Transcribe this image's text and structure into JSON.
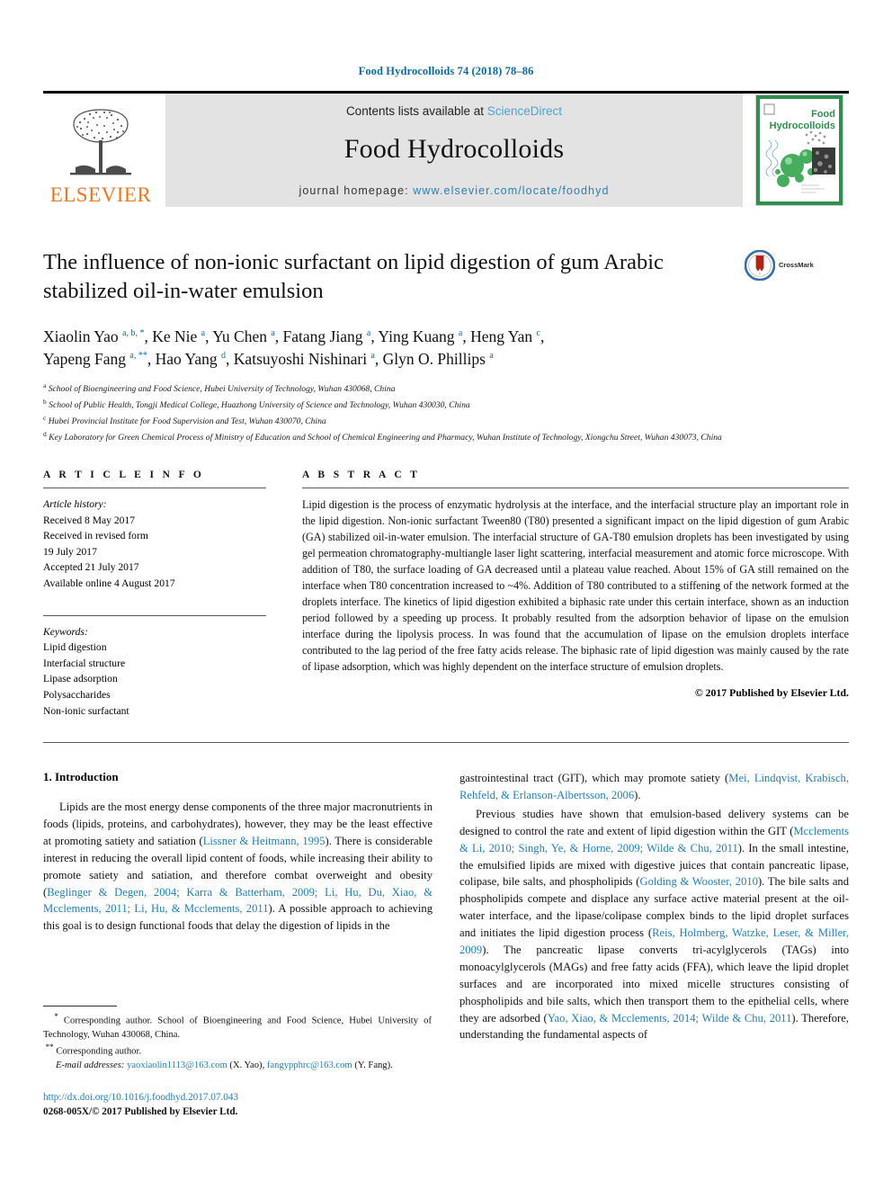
{
  "running_head": "Food Hydrocolloids 74 (2018) 78–86",
  "masthead": {
    "elsevier_wordmark": "ELSEVIER",
    "contents_prefix": "Contents lists available at ",
    "sciencedirect": "ScienceDirect",
    "journal_title": "Food Hydrocolloids",
    "homepage_prefix": "journal homepage: ",
    "homepage_url": "www.elsevier.com/locate/foodhyd",
    "cover_title_line1": "Food",
    "cover_title_line2": "Hydrocolloids",
    "accent_orange": "#e87722",
    "accent_blue": "#2b7fb8",
    "cover_green": "#2f8f4e",
    "banner_bg": "#e3e3e3"
  },
  "article": {
    "title": "The influence of non-ionic surfactant on lipid digestion of gum Arabic stabilized oil-in-water emulsion",
    "crossmark_label": "CrossMark",
    "authors_line1": "Xiaolin Yao a, b, *, Ke Nie a, Yu Chen a, Fatang Jiang a, Ying Kuang a, Heng Yan c,",
    "authors_line2": "Yapeng Fang a, **, Hao Yang d, Katsuyoshi Nishinari a, Glyn O. Phillips a",
    "affiliations": [
      {
        "mark": "a",
        "text": "School of Bioengineering and Food Science, Hubei University of Technology, Wuhan 430068, China"
      },
      {
        "mark": "b",
        "text": "School of Public Health, Tongji Medical College, Huazhong University of Science and Technology, Wuhan 430030, China"
      },
      {
        "mark": "c",
        "text": "Hubei Provincial Institute for Food Supervision and Test, Wuhan 430070, China"
      },
      {
        "mark": "d",
        "text": "Key Laboratory for Green Chemical Process of Ministry of Education and School of Chemical Engineering and Pharmacy, Wuhan Institute of Technology, Xiongchu Street, Wuhan 430073, China"
      }
    ]
  },
  "article_info": {
    "heading": "A R T I C L E  I N F O",
    "history_title": "Article history:",
    "history_lines": [
      "Received 8 May 2017",
      "Received in revised form",
      "19 July 2017",
      "Accepted 21 July 2017",
      "Available online 4 August 2017"
    ],
    "keywords_title": "Keywords:",
    "keywords": [
      "Lipid digestion",
      "Interfacial structure",
      "Lipase adsorption",
      "Polysaccharides",
      "Non-ionic surfactant"
    ]
  },
  "abstract": {
    "heading": "A B S T R A C T",
    "body": "Lipid digestion is the process of enzymatic hydrolysis at the interface, and the interfacial structure play an important role in the lipid digestion. Non-ionic surfactant Tween80 (T80) presented a significant impact on the lipid digestion of gum Arabic (GA) stabilized oil-in-water emulsion. The interfacial structure of GA-T80 emulsion droplets has been investigated by using gel permeation chromatography-multiangle laser light scattering, interfacial measurement and atomic force microscope. With addition of T80, the surface loading of GA decreased until a plateau value reached. About 15% of GA still remained on the interface when T80 concentration increased to ~4%. Addition of T80 contributed to a stiffening of the network formed at the droplets interface. The kinetics of lipid digestion exhibited a biphasic rate under this certain interface, shown as an induction period followed by a speeding up process. It probably resulted from the adsorption behavior of lipase on the emulsion interface during the lipolysis process. In was found that the accumulation of lipase on the emulsion droplets interface contributed to the lag period of the free fatty acids release. The biphasic rate of lipid digestion was mainly caused by the rate of lipase adsorption, which was highly dependent on the interface structure of emulsion droplets.",
    "copyright": "© 2017 Published by Elsevier Ltd."
  },
  "introduction": {
    "heading": "1.  Introduction",
    "left_para1_a": "Lipids are the most energy dense components of the three major macronutrients in foods (lipids, proteins, and carbohydrates), however, they may be the least effective at promoting satiety and satiation (",
    "left_para1_ref1": "Lissner & Heitmann, 1995",
    "left_para1_b": "). There is considerable interest in reducing the overall lipid content of foods, while increasing their ability to promote satiety and satiation, and therefore combat overweight and obesity (",
    "left_para1_ref2": "Beglinger & Degen, 2004; Karra & Batterham, 2009; Li, Hu, Du, Xiao, & Mcclements, 2011; Li, Hu, & Mcclements, 2011",
    "left_para1_c": "). A possible approach to achieving this goal is to design functional foods that delay the digestion of lipids in the",
    "right_para1_a": "gastrointestinal tract (GIT), which may promote satiety (",
    "right_para1_ref": "Mei, Lindqvist, Krabisch, Rehfeld, & Erlanson-Albertsson, 2006",
    "right_para1_b": ").",
    "right_para2_a": "Previous studies have shown that emulsion-based delivery systems can be designed to control the rate and extent of lipid digestion within the GIT (",
    "right_para2_ref1": "Mcclements & Li, 2010; Singh, Ye, & Horne, 2009; Wilde & Chu, 2011",
    "right_para2_b": "). In the small intestine, the emulsified lipids are mixed with digestive juices that contain pancreatic lipase, colipase, bile salts, and phospholipids (",
    "right_para2_ref2": "Golding & Wooster, 2010",
    "right_para2_c": "). The bile salts and phospholipids compete and displace any surface active material present at the oil-water interface, and the lipase/colipase complex binds to the lipid droplet surfaces and initiates the lipid digestion process (",
    "right_para2_ref3": "Reis, Holmberg, Watzke, Leser, & Miller, 2009",
    "right_para2_d": "). The pancreatic lipase converts tri-acylglycerols (TAGs) into monoacylglycerols (MAGs) and free fatty acids (FFA), which leave the lipid droplet surfaces and are incorporated into mixed micelle structures consisting of phospholipids and bile salts, which then transport them to the epithelial cells, where they are adsorbed (",
    "right_para2_ref4": "Yao, Xiao, & Mcclements, 2014; Wilde & Chu, 2011",
    "right_para2_e": "). Therefore, understanding the fundamental aspects of"
  },
  "footnotes": {
    "corr1_mark": "*",
    "corr1": "Corresponding author. School of Bioengineering and Food Science, Hubei University of Technology, Wuhan 430068, China.",
    "corr2_mark": "**",
    "corr2": "Corresponding author.",
    "email_label": "E-mail addresses:",
    "email1": "yaoxiaolin1113@163.com",
    "email1_who": "(X. Yao)",
    "email2": "fangypphrc@163.com",
    "email2_who": "(Y. Fang)."
  },
  "footer": {
    "doi": "http://dx.doi.org/10.1016/j.foodhyd.2017.07.043",
    "issn": "0268-005X/© 2017 Published by Elsevier Ltd."
  }
}
